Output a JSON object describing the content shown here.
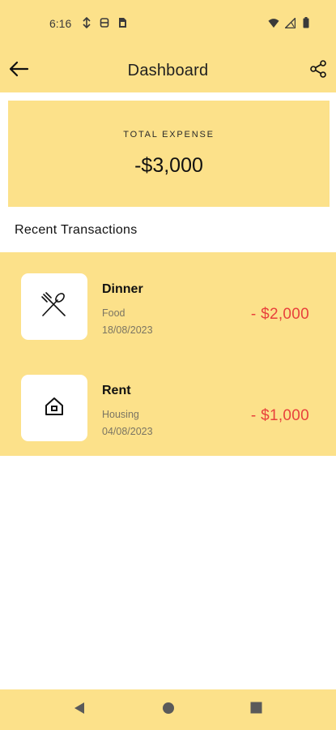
{
  "status_bar": {
    "time": "6:16",
    "left_icons": [
      "data-saver-icon",
      "vpn-key-icon",
      "sim-card-icon"
    ],
    "right_icons": [
      "wifi-icon",
      "signal-icon",
      "battery-icon"
    ]
  },
  "app_bar": {
    "title": "Dashboard",
    "back_icon": "arrow-left-icon",
    "share_icon": "share-icon"
  },
  "summary": {
    "label": "TOTAL EXPENSE",
    "value": "-$3,000"
  },
  "section_title": "Recent Transactions",
  "transactions": [
    {
      "name": "Dinner",
      "category": "Food",
      "date": "18/08/2023",
      "amount": "- $2,000",
      "icon": "fork-knife-icon"
    },
    {
      "name": "Rent",
      "category": "Housing",
      "date": "04/08/2023",
      "amount": "- $1,000",
      "icon": "home-icon"
    }
  ],
  "colors": {
    "accent": "#fce18a",
    "negative": "#e8413c",
    "muted_text": "#7b7563"
  },
  "nav_bar": [
    "back-triangle-icon",
    "home-circle-icon",
    "recents-square-icon"
  ]
}
